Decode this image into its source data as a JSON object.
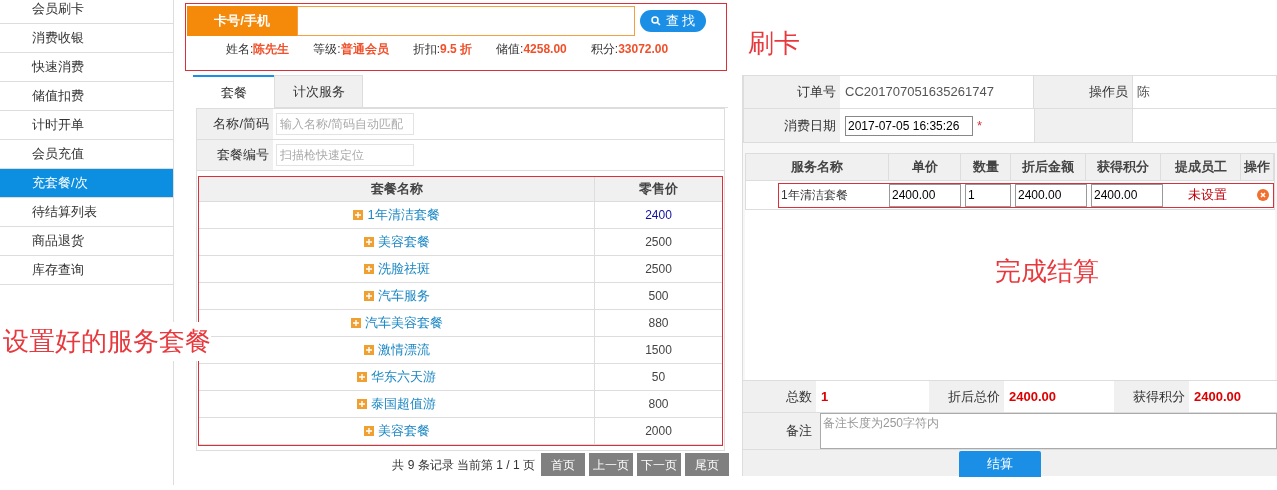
{
  "sidebar": {
    "items": [
      {
        "label": "会员刷卡",
        "selected": false
      },
      {
        "label": "消费收银",
        "selected": false
      },
      {
        "label": "快速消费",
        "selected": false
      },
      {
        "label": "储值扣费",
        "selected": false
      },
      {
        "label": "计时开单",
        "selected": false
      },
      {
        "label": "会员充值",
        "selected": false
      },
      {
        "label": "充套餐/次",
        "selected": true
      },
      {
        "label": "待结算列表",
        "selected": false
      },
      {
        "label": "商品退货",
        "selected": false
      },
      {
        "label": "库存查询",
        "selected": false
      }
    ]
  },
  "search": {
    "label": "卡号/手机",
    "button": "查 找"
  },
  "member_info": [
    {
      "label": "姓名:",
      "value": "陈先生"
    },
    {
      "label": "等级:",
      "value": "普通会员"
    },
    {
      "label": "折扣:",
      "value": "9.5 折"
    },
    {
      "label": "储值:",
      "value": "4258.00"
    },
    {
      "label": "积分:",
      "value": "33072.00"
    }
  ],
  "tabs": [
    {
      "label": "套餐",
      "selected": true
    },
    {
      "label": "计次服务",
      "selected": false
    }
  ],
  "filters": [
    {
      "label": "名称/简码",
      "placeholder": "输入名称/简码自动匹配"
    },
    {
      "label": "套餐编号",
      "placeholder": "扫描枪快速定位"
    }
  ],
  "packages": {
    "columns": [
      "套餐名称",
      "零售价"
    ],
    "rows": [
      {
        "name": "1年清洁套餐",
        "price": "2400",
        "highlighted": true
      },
      {
        "name": "美容套餐",
        "price": "2500",
        "highlighted": false
      },
      {
        "name": "洗脸祛斑",
        "price": "2500",
        "highlighted": false
      },
      {
        "name": "汽车服务",
        "price": "500",
        "highlighted": false
      },
      {
        "name": "汽车美容套餐",
        "price": "880",
        "highlighted": false
      },
      {
        "name": "激情漂流",
        "price": "1500",
        "highlighted": false
      },
      {
        "name": "华东六天游",
        "price": "50",
        "highlighted": false
      },
      {
        "name": "泰国超值游",
        "price": "800",
        "highlighted": false
      },
      {
        "name": "美容套餐",
        "price": "2000",
        "highlighted": false
      }
    ]
  },
  "pagination": {
    "summary": "共 9 条记录 当前第 1 / 1 页",
    "buttons": [
      "首页",
      "上一页",
      "下一页",
      "尾页"
    ]
  },
  "order": {
    "order_no": {
      "label": "订单号",
      "value": "CC201707051635261747"
    },
    "operator": {
      "label": "操作员",
      "value": "陈"
    },
    "date": {
      "label": "消费日期",
      "value": "2017-07-05 16:35:26",
      "required": "*"
    }
  },
  "order_items": {
    "columns": [
      "服务名称",
      "单价",
      "数量",
      "折后金额",
      "获得积分",
      "提成员工",
      "操作"
    ],
    "rows": [
      {
        "name": "1年清洁套餐",
        "unit_price": "2400.00",
        "quantity": "1",
        "discounted": "2400.00",
        "points": "2400.00",
        "staff": "未设置"
      }
    ]
  },
  "totals": [
    {
      "label": "总数",
      "value": "1"
    },
    {
      "label": "折后总价",
      "value": "2400.00"
    },
    {
      "label": "获得积分",
      "value": "2400.00"
    }
  ],
  "remark": {
    "label": "备注",
    "placeholder": "备注长度为250字符内"
  },
  "submit": "结算",
  "annotations": [
    {
      "text": "刷卡"
    },
    {
      "text": "完成结算"
    },
    {
      "text": "设置好的服务套餐"
    }
  ]
}
